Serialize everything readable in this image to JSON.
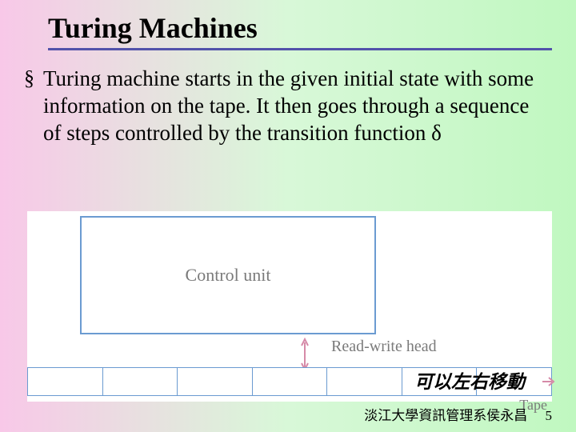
{
  "title": "Turing Machines",
  "body": "Turing machine starts in the given initial state with some information on the tape. It then goes through a sequence of steps controlled by the transition function δ",
  "figure": {
    "control_unit": "Control unit",
    "read_write_head": "Read-write head",
    "tape": "Tape",
    "annotation": "可以左右移動"
  },
  "footer": {
    "affiliation": "淡江大學資訊管理系侯永昌",
    "page": "5"
  }
}
